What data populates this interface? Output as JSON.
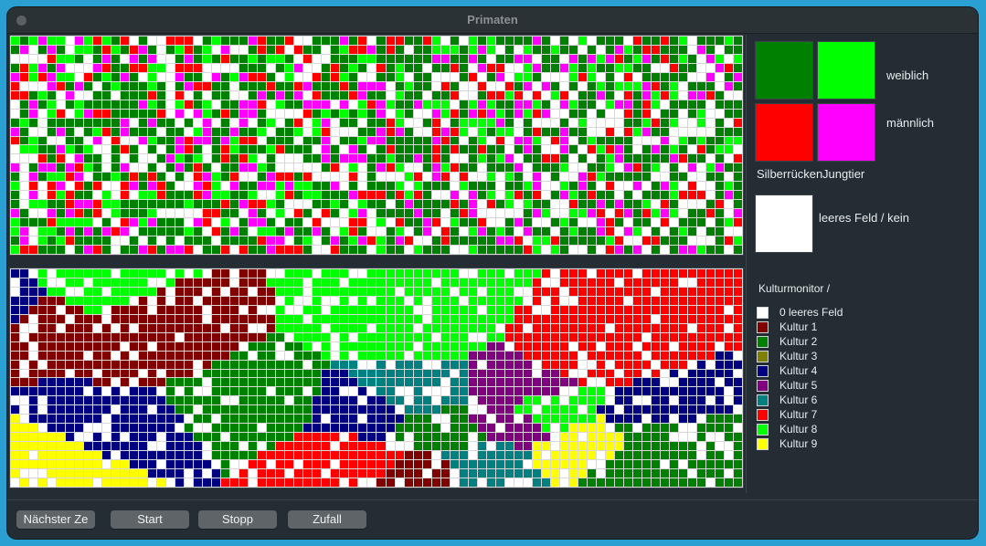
{
  "window": {
    "title": "Primaten"
  },
  "creature_legend": {
    "female_label": "weiblich",
    "male_label": "männlich",
    "silverback_label": "Silberrücken",
    "young_label": "Jungtier",
    "empty_label": "leeres Feld / kein",
    "colors": {
      "female_adult": "#008000",
      "female_young": "#00ff00",
      "male_adult": "#ff0000",
      "male_young": "#ff00ff",
      "empty": "#ffffff"
    }
  },
  "culture_monitor": {
    "title": "Kulturmonitor /",
    "items": [
      {
        "label": "0 leeres Feld",
        "color": "#ffffff"
      },
      {
        "label": "Kultur 1",
        "color": "#800000"
      },
      {
        "label": "Kultur 2",
        "color": "#008000"
      },
      {
        "label": "Kultur 3",
        "color": "#808000"
      },
      {
        "label": "Kultur 4",
        "color": "#000080"
      },
      {
        "label": "Kultur 5",
        "color": "#800080"
      },
      {
        "label": "Kultur 6",
        "color": "#008080"
      },
      {
        "label": "Kultur 7",
        "color": "#ff0000"
      },
      {
        "label": "Kultur 8",
        "color": "#00ff00"
      },
      {
        "label": "Kultur 9",
        "color": "#ffff00"
      }
    ]
  },
  "buttons": {
    "next_step": "Nächster Ze",
    "start": "Start",
    "stop": "Stopp",
    "random": "Zufall"
  }
}
